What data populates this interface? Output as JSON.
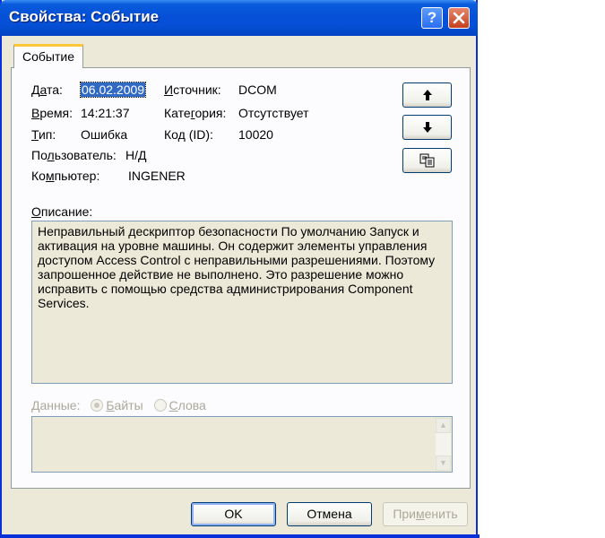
{
  "window": {
    "title": "Свойства: Событие",
    "help_label": "?"
  },
  "tab": {
    "label": "Событие"
  },
  "fields": {
    "date_label_a": "Д",
    "date_label_u": "а",
    "date_label_b": "та:",
    "date_value": "06.02.2009",
    "time_label_u": "В",
    "time_label_b": "ремя:",
    "time_value": "14:21:37",
    "type_label_u": "Т",
    "type_label_b": "ип:",
    "type_value": "Ошибка",
    "user_label_a": "По",
    "user_label_u": "л",
    "user_label_b": "ьзователь:",
    "user_value": "Н/Д",
    "computer_label_a": "Ко",
    "computer_label_u": "м",
    "computer_label_b": "пьютер:",
    "computer_value": "INGENER",
    "source_label_u": "И",
    "source_label_b": "сточник:",
    "source_value": "DCOM",
    "category_label_a": "Кате",
    "category_label_u": "г",
    "category_label_b": "ория:",
    "category_value": "Отсутствует",
    "code_label_a": "Ко",
    "code_label_u": "д",
    "code_label_b": " (ID):",
    "code_value": "10020"
  },
  "description": {
    "label_u": "О",
    "label_b": "писание:",
    "lines": [
      "Неправильный дескриптор безопасности По умолчанию Запуск и",
      "активация на уровне машины. Он содержит  элементы управления",
      "доступом Access Control с неправильными разрешениями. Поэтому",
      "запрошенное действие не выполнено. Это разрешение можно",
      "исправить с помощью средства администрирования Component",
      "Services."
    ]
  },
  "data": {
    "label": "Данные:",
    "bytes_u": "Б",
    "bytes_b": "айты",
    "words_u": "С",
    "words_b": "лова",
    "selected": "Байты"
  },
  "buttons": {
    "ok": "OK",
    "cancel": "Отмена",
    "apply_a": "При",
    "apply_u": "м",
    "apply_b": "енить"
  },
  "icons": {
    "up": "arrow-up-icon",
    "down": "arrow-down-icon",
    "copy": "copy-icon"
  },
  "colors": {
    "title_bar": "#0550d6",
    "dialog_bg": "#ece9d8",
    "selection": "#316ac5"
  }
}
